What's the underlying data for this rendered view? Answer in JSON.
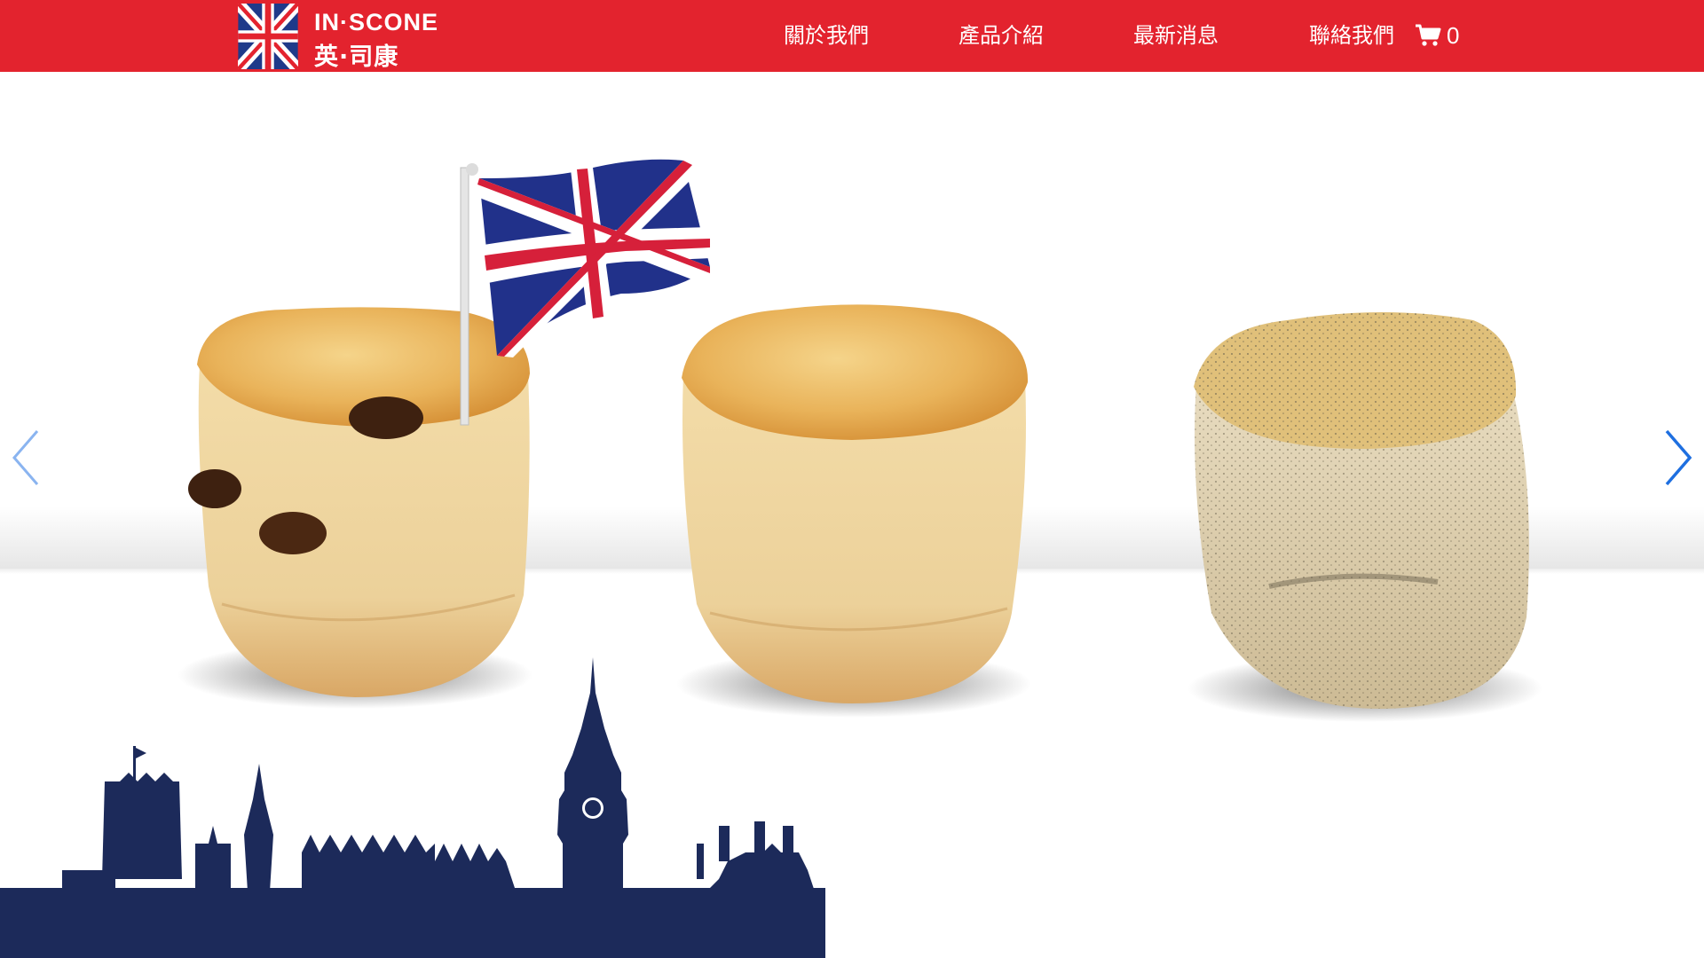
{
  "brand": {
    "name_en": "IN·SCONE",
    "name_zh": "英·司康",
    "logo_icon": "union-jack-icon",
    "header_color": "#e3232e"
  },
  "nav": {
    "items": [
      {
        "label": "關於我們"
      },
      {
        "label": "產品介紹"
      },
      {
        "label": "最新消息"
      },
      {
        "label": "聯絡我們"
      }
    ],
    "cart": {
      "icon": "cart-icon",
      "count": "0"
    }
  },
  "hero": {
    "slides_controls": {
      "prev_icon": "chevron-left-icon",
      "next_icon": "chevron-right-icon"
    },
    "images": [
      "union-jack-flag",
      "raisin-scone",
      "plain-scone",
      "earl-grey-scone",
      "london-skyline-silhouette"
    ],
    "skyline_color": "#1c2a5a"
  }
}
